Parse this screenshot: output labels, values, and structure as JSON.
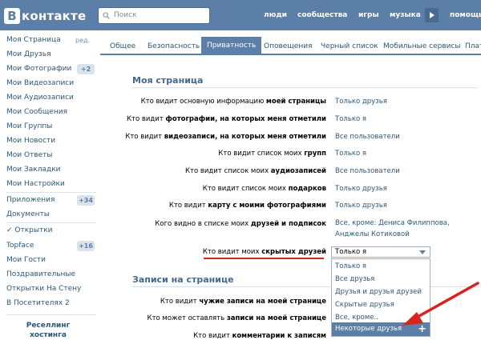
{
  "header": {
    "logo_text": "контакте",
    "logo_letter": "В",
    "search_placeholder": "Поиск",
    "nav": [
      "люди",
      "сообщества",
      "игры",
      "музыка",
      "помощь"
    ]
  },
  "sidebar": {
    "items": [
      {
        "label": "Моя Страница",
        "aside": "ред."
      },
      {
        "label": "Мои Друзья"
      },
      {
        "label": "Мои Фотографии",
        "badge": "+2"
      },
      {
        "label": "Мои Видеозаписи"
      },
      {
        "label": "Мои Аудиозаписи"
      },
      {
        "label": "Мои Сообщения"
      },
      {
        "label": "Мои Группы"
      },
      {
        "label": "Мои Новости"
      },
      {
        "label": "Мои Ответы"
      },
      {
        "label": "Мои Закладки"
      },
      {
        "label": "Мои Настройки"
      },
      {
        "label": "Приложения",
        "badge": "+34"
      },
      {
        "label": "Документы"
      },
      {
        "label": "✓ Открытки"
      },
      {
        "label": "Topface",
        "badge": "+16"
      },
      {
        "label": "Мои Гости"
      },
      {
        "label": "Поздравительные"
      },
      {
        "label": "Открытки На Стену"
      },
      {
        "label": "В Посетителях 2"
      }
    ],
    "promo_line1": "Реселлинг",
    "promo_line2": "хостинга"
  },
  "tabs": [
    "Общее",
    "Безопасность",
    "Приватность",
    "Оповещения",
    "Черный список",
    "Мобильные сервисы",
    "Плат"
  ],
  "sections": {
    "my_page": "Моя страница",
    "wall": "Записи на странице"
  },
  "rows": [
    {
      "q_pre": "Кто видит основную информацию ",
      "q_bold": "моей страницы",
      "q_post": "",
      "answer": "Только друзья"
    },
    {
      "q_pre": "Кто видит ",
      "q_bold": "фотографии, на которых меня отметили",
      "q_post": "",
      "answer": "Только я"
    },
    {
      "q_pre": "Кто видит ",
      "q_bold": "видеозаписи, на которых меня отметили",
      "q_post": "",
      "answer": "Все пользователи"
    },
    {
      "q_pre": "Кто видит список моих ",
      "q_bold": "групп",
      "q_post": "",
      "answer": "Только я"
    },
    {
      "q_pre": "Кто видит список моих ",
      "q_bold": "аудиозаписей",
      "q_post": "",
      "answer": "Все пользователи"
    },
    {
      "q_pre": "Кто видит список моих ",
      "q_bold": "подарков",
      "q_post": "",
      "answer": "Только друзья"
    },
    {
      "q_pre": "Кто видит ",
      "q_bold": "карту с моими фотографиями",
      "q_post": "",
      "answer": "Только друзья"
    },
    {
      "q_pre": "Кого видно в списке моих ",
      "q_bold": "друзей и подписок",
      "q_post": "",
      "answer": "Все, кроме: Дениса Филиппова, Анджелы Котиковой"
    },
    {
      "q_pre": "Кто видит моих ",
      "q_bold": "скрытых друзей",
      "q_post": "",
      "answer": "Только я"
    }
  ],
  "wall_rows": [
    {
      "q_pre": "Кто видит ",
      "q_bold": "чужие записи на моей странице",
      "q_post": ""
    },
    {
      "q_pre": "Кто может оставлять ",
      "q_bold": "записи на моей странице",
      "q_post": ""
    },
    {
      "q_pre": "Кто видит ",
      "q_bold": "комментарии к записям",
      "q_post": ""
    }
  ],
  "dropdown": {
    "selected": "Только я",
    "options": [
      "Только я",
      "Все друзья",
      "Друзья и друзья друзей",
      "Скрытые друзья",
      "Все, кроме..",
      "Некоторые друзья"
    ],
    "highlighted_index": 5,
    "plus": "+"
  },
  "colors": {
    "header": "#5b7fa6",
    "link": "#2b587a",
    "accent": "#5b7fa6",
    "annotation": "#d9241c"
  }
}
